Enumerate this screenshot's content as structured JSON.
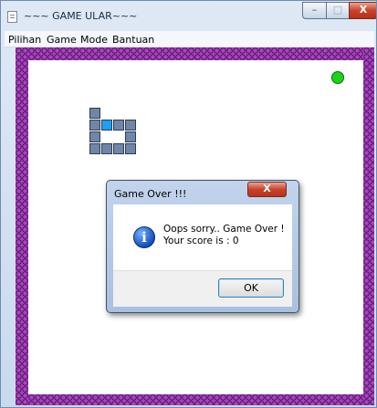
{
  "window": {
    "title": "~~~ GAME ULAR~~~",
    "minimize_glyph": "–",
    "maximize_glyph": "□",
    "close_glyph": "X"
  },
  "menu": {
    "items": [
      {
        "label": "Pilihan"
      },
      {
        "label": "Game"
      },
      {
        "label": "Mode"
      },
      {
        "label": "Bantuan"
      }
    ]
  },
  "game": {
    "wall_color": "#b040c8",
    "food_color": "#19d619",
    "snake_color": "#6f86a8",
    "snake_head_color": "#1e9ff0",
    "food_icon": "green-circle"
  },
  "dialog": {
    "title": "Game Over !!!",
    "close_glyph": "X",
    "icon": "info-icon",
    "message_line1": "Oops sorry.. Game Over !",
    "message_line2": "Your score is : 0",
    "ok_label": "OK"
  }
}
